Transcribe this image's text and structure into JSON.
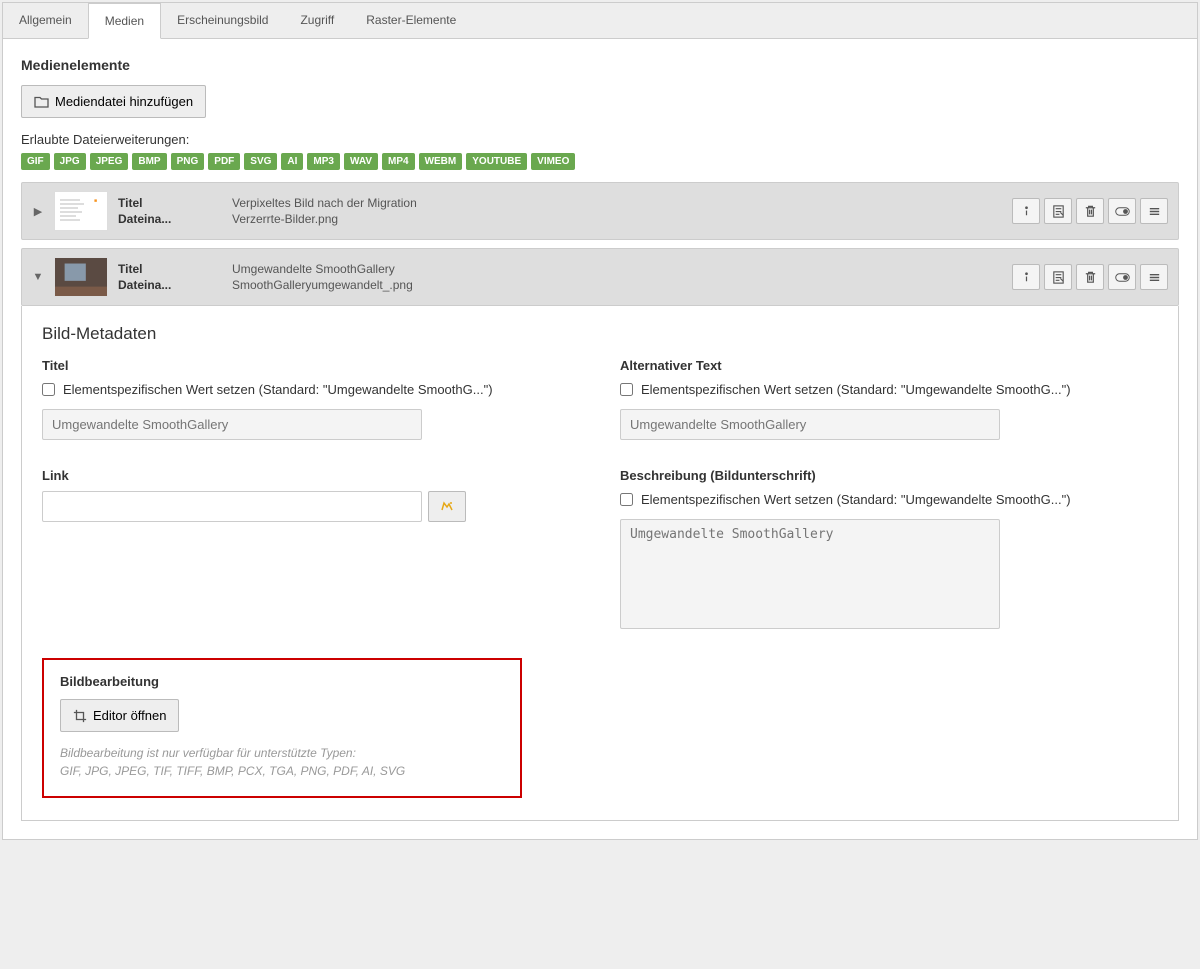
{
  "tabs": [
    "Allgemein",
    "Medien",
    "Erscheinungsbild",
    "Zugriff",
    "Raster-Elemente"
  ],
  "activeTab": 1,
  "section_title": "Medienelemente",
  "add_button": "Mediendatei hinzufügen",
  "allowed_label": "Erlaubte Dateierweiterungen:",
  "badges": [
    "GIF",
    "JPG",
    "JPEG",
    "BMP",
    "PNG",
    "PDF",
    "SVG",
    "AI",
    "MP3",
    "WAV",
    "MP4",
    "WEBM",
    "YOUTUBE",
    "VIMEO"
  ],
  "rows": [
    {
      "titlek": "Titel",
      "titlev": "Verpixeltes Bild nach der Migration",
      "filek": "Dateina...",
      "filev": "Verzerrte-Bilder.png",
      "open": false
    },
    {
      "titlek": "Titel",
      "titlev": "Umgewandelte SmoothGallery",
      "filek": "Dateina...",
      "filev": "SmoothGalleryumgewandelt_.png",
      "open": true
    }
  ],
  "meta": {
    "heading": "Bild-Metadaten",
    "titel_label": "Titel",
    "titel_chk": "Elementspezifischen Wert setzen (Standard: \"Umgewandelte SmoothG...\")",
    "titel_ph": "Umgewandelte SmoothGallery",
    "alt_label": "Alternativer Text",
    "alt_chk": "Elementspezifischen Wert setzen (Standard: \"Umgewandelte SmoothG...\")",
    "alt_ph": "Umgewandelte SmoothGallery",
    "link_label": "Link",
    "desc_label": "Beschreibung (Bildunterschrift)",
    "desc_chk": "Elementspezifischen Wert setzen (Standard: \"Umgewandelte SmoothG...\")",
    "desc_ph": "Umgewandelte SmoothGallery"
  },
  "edit": {
    "heading": "Bildbearbeitung",
    "button": "Editor öffnen",
    "note1": "Bildbearbeitung ist nur verfügbar für unterstützte Typen:",
    "note2": "GIF, JPG, JPEG, TIF, TIFF, BMP, PCX, TGA, PNG, PDF, AI, SVG"
  }
}
